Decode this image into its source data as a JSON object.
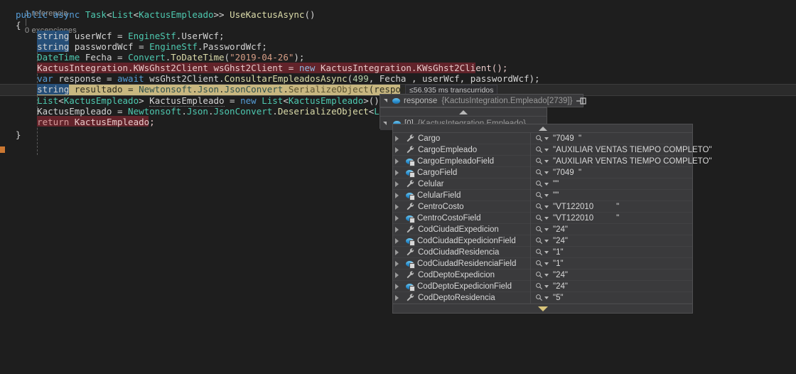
{
  "editor": {
    "codelens": {
      "references": "1 referencia",
      "separator": "|",
      "exceptions": "0 excepciones"
    },
    "lines": [
      {
        "indent": 0,
        "html_id": "l1",
        "text": "public async Task<List<KactusEmpleado>> UseKactusAsync()"
      },
      {
        "indent": 0,
        "html_id": "l2",
        "text": "{"
      },
      {
        "indent": 1,
        "html_id": "l3",
        "text": "string userWcf = EngineStf.UserWcf;"
      },
      {
        "indent": 1,
        "html_id": "l4",
        "text": "string passwordWcf = EngineStf.PasswordWcf;"
      },
      {
        "indent": 1,
        "html_id": "l5",
        "text": "DateTime Fecha = Convert.ToDateTime(\"2019-04-26\");"
      },
      {
        "indent": 1,
        "html_id": "l6",
        "text": "KactusIntegration.KWsGhst2Client wsGhst2Client = new KactusIntegration.KWsGhst2Client();"
      },
      {
        "indent": 1,
        "html_id": "l7",
        "text": "var response = await wsGhst2Client.ConsultarEmpleadosAsync(499, Fecha , userWcf, passwordWcf);"
      },
      {
        "indent": 1,
        "html_id": "l8",
        "text": "string resultado = Newtonsoft.Json.JsonConvert.SerializeObject(response);"
      },
      {
        "indent": 1,
        "html_id": "l9",
        "text": "List<KactusEmpleado> KactusEmpleado = new List<KactusEmpleado>();"
      },
      {
        "indent": 1,
        "html_id": "l10",
        "text": "KactusEmpleado = Newtonsoft.Json.JsonConvert.DeserializeObject<List<K"
      },
      {
        "indent": 1,
        "html_id": "l11",
        "text": "return KactusEmpleado;"
      },
      {
        "indent": 0,
        "html_id": "l12",
        "text": "}"
      }
    ],
    "elapsed_adornment": "≤56.935 ms transcurridos"
  },
  "datatip": {
    "header": {
      "name": "response",
      "value": "{KactusIntegration.Empleado[2739]}",
      "pin_icon": "unpin-icon"
    },
    "element_row": {
      "index": "[0]",
      "value": "{KactusIntegration.Empleado}"
    },
    "scroll_up_icon": "scroll-up-arrow",
    "scroll_down_icon": "scroll-down-arrow",
    "rows": [
      {
        "icon": "property-wrench-icon",
        "name": "Cargo",
        "value": "\"7049  \""
      },
      {
        "icon": "property-wrench-icon",
        "name": "CargoEmpleado",
        "value": "\"AUXILIAR VENTAS TIEMPO COMPLETO\""
      },
      {
        "icon": "private-field-icon",
        "name": "CargoEmpleadoField",
        "value": "\"AUXILIAR VENTAS TIEMPO COMPLETO\""
      },
      {
        "icon": "private-field-icon",
        "name": "CargoField",
        "value": "\"7049  \""
      },
      {
        "icon": "property-wrench-icon",
        "name": "Celular",
        "value": "\"\""
      },
      {
        "icon": "private-field-icon",
        "name": "CelularField",
        "value": "\"\""
      },
      {
        "icon": "property-wrench-icon",
        "name": "CentroCosto",
        "value": "\"VT122010          \""
      },
      {
        "icon": "private-field-icon",
        "name": "CentroCostoField",
        "value": "\"VT122010          \""
      },
      {
        "icon": "property-wrench-icon",
        "name": "CodCiudadExpedicion",
        "value": "\"24\""
      },
      {
        "icon": "private-field-icon",
        "name": "CodCiudadExpedicionField",
        "value": "\"24\""
      },
      {
        "icon": "property-wrench-icon",
        "name": "CodCiudadResidencia",
        "value": "\"1\""
      },
      {
        "icon": "private-field-icon",
        "name": "CodCiudadResidenciaField",
        "value": "\"1\""
      },
      {
        "icon": "property-wrench-icon",
        "name": "CodDeptoExpedicion",
        "value": "\"24\""
      },
      {
        "icon": "private-field-icon",
        "name": "CodDeptoExpedicionField",
        "value": "\"24\""
      },
      {
        "icon": "property-wrench-icon",
        "name": "CodDeptoResidencia",
        "value": "\"5\""
      }
    ]
  },
  "colors": {
    "editor_bg": "#1e1e1e",
    "page_bg": "#252526",
    "breakpoint_line_bg": "#62232a",
    "current_statement_bg": "#c8b780",
    "selection_bg": "#264f78",
    "keyword": "#569cd6",
    "type": "#4ec9b0",
    "string": "#d69d85",
    "number": "#b5cea8",
    "method": "#dcdcaa",
    "tip_bg": "#3a3a3c",
    "tip_border": "#515153"
  }
}
